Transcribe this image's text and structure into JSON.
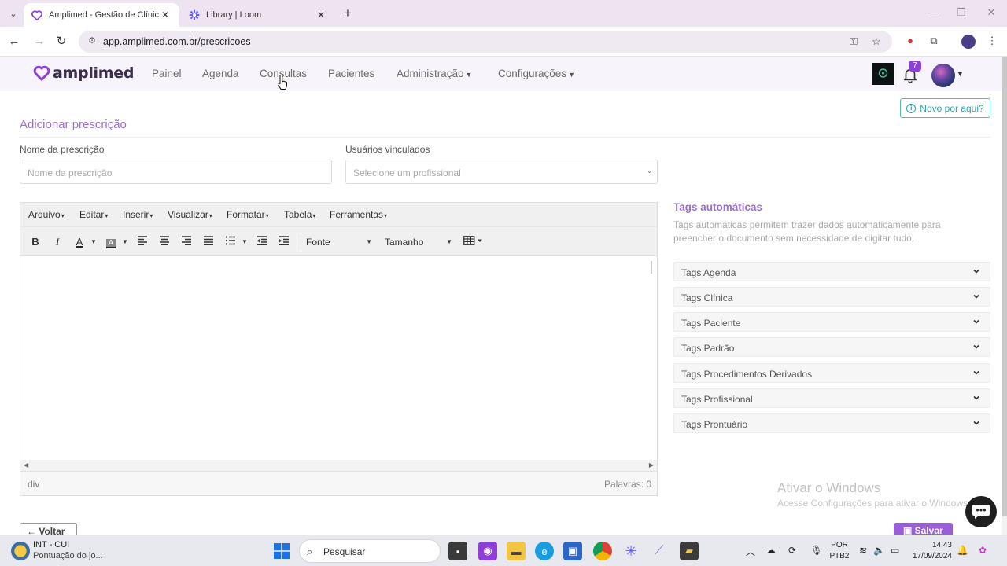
{
  "browser": {
    "tabs": [
      {
        "title": "Amplimed - Gestão de Clínicas",
        "active": true,
        "favicon": "heart-icon"
      },
      {
        "title": "Library | Loom",
        "active": false,
        "favicon": "loom-icon"
      }
    ],
    "url": "app.amplimed.com.br/prescricoes"
  },
  "navbar": {
    "logo": "amplimed",
    "menu": [
      {
        "label": "Painel"
      },
      {
        "label": "Agenda"
      },
      {
        "label": "Consultas"
      },
      {
        "label": "Pacientes"
      },
      {
        "label": "Administração"
      },
      {
        "label": "Configurações"
      }
    ],
    "notifications_count": "7"
  },
  "page": {
    "title": "Adicionar prescrição",
    "help_button": "Novo por aqui?",
    "name_label": "Nome da prescrição",
    "name_placeholder": "Nome da prescrição",
    "users_label": "Usuários vinculados",
    "users_placeholder": "Selecione um profissional",
    "back_button": "Voltar",
    "save_button": "Salvar"
  },
  "editor": {
    "menus": [
      "Arquivo",
      "Editar",
      "Inserir",
      "Visualizar",
      "Formatar",
      "Tabela",
      "Ferramentas"
    ],
    "font_select": "Fonte",
    "size_select": "Tamanho",
    "path": "div",
    "word_count": "Palavras: 0"
  },
  "tags_panel": {
    "title": "Tags automáticas",
    "description": "Tags automáticas permitem trazer dados automaticamente para preencher o documento sem necessidade de digitar tudo.",
    "items": [
      {
        "label": "Tags Agenda"
      },
      {
        "label": "Tags Clínica"
      },
      {
        "label": "Tags Paciente"
      },
      {
        "label": "Tags Padrão"
      },
      {
        "label": "Tags Procedimentos Derivados"
      },
      {
        "label": "Tags Profissional"
      },
      {
        "label": "Tags Prontuário"
      }
    ]
  },
  "watermark": {
    "title": "Ativar o Windows",
    "subtitle": "Acesse Configurações para ativar o Windows."
  },
  "taskbar": {
    "weather_title": "INT - CUI",
    "weather_sub": "Pontuação do jo...",
    "search": "Pesquisar",
    "lang1": "POR",
    "lang2": "PTB2",
    "time": "14:43",
    "date": "17/09/2024"
  },
  "colors": {
    "brand": "#9c70d2",
    "accent_teal": "#2aa6aa",
    "save": "#9a5ed8",
    "badge": "#8e3fd8"
  }
}
